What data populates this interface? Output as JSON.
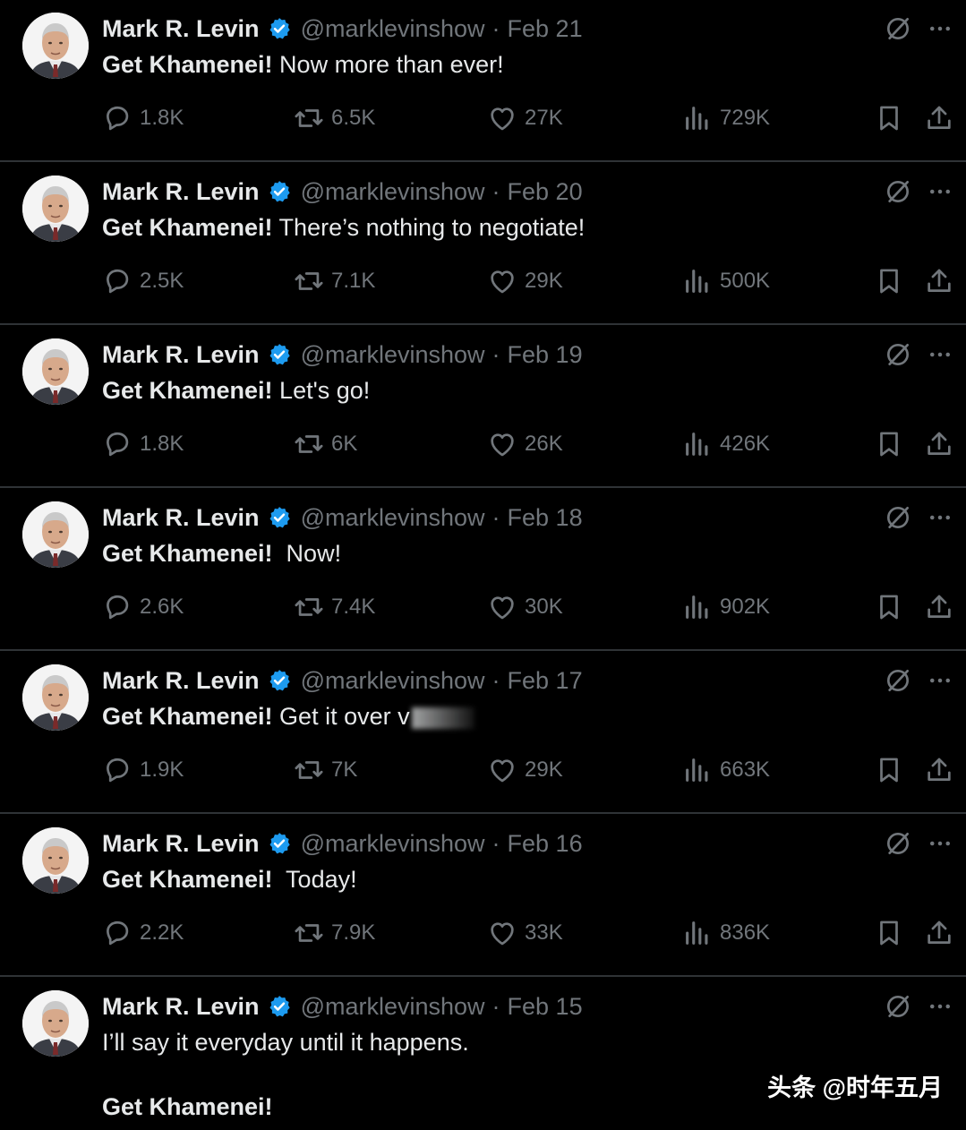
{
  "account": {
    "name": "Mark R. Levin",
    "handle": "@marklevinshow",
    "separator": "·"
  },
  "colors": {
    "background": "#000000",
    "verified": "#1d9bf0",
    "muted": "#71767b",
    "text": "#e7e9ea"
  },
  "icons": {
    "reply": "reply-icon",
    "retweet": "retweet-icon",
    "like": "like-icon",
    "views": "views-icon",
    "bookmark": "bookmark-icon",
    "share": "share-icon",
    "grok": "grok-icon",
    "more": "more-icon",
    "verified": "verified-badge-icon"
  },
  "tweets": [
    {
      "date": "Feb 21",
      "text_bold": "Get Khamenei!",
      "text_rest": " Now more than ever!",
      "replies": "1.8K",
      "retweets": "6.5K",
      "likes": "27K",
      "views": "729K"
    },
    {
      "date": "Feb 20",
      "text_bold": "Get Khamenei!",
      "text_rest": " There’s nothing to negotiate!",
      "replies": "2.5K",
      "retweets": "7.1K",
      "likes": "29K",
      "views": "500K"
    },
    {
      "date": "Feb 19",
      "text_bold": "Get Khamenei!",
      "text_rest": " Let's go!",
      "replies": "1.8K",
      "retweets": "6K",
      "likes": "26K",
      "views": "426K"
    },
    {
      "date": "Feb 18",
      "text_bold": "Get Khamenei!",
      "text_rest": "  Now!",
      "replies": "2.6K",
      "retweets": "7.4K",
      "likes": "30K",
      "views": "902K"
    },
    {
      "date": "Feb 17",
      "text_bold": "Get Khamenei!",
      "text_rest": " Get it over v",
      "replies": "1.9K",
      "retweets": "7K",
      "likes": "29K",
      "views": "663K"
    },
    {
      "date": "Feb 16",
      "text_bold": "Get Khamenei!",
      "text_rest": "  Today!",
      "replies": "2.2K",
      "retweets": "7.9K",
      "likes": "33K",
      "views": "836K"
    },
    {
      "date": "Feb 15",
      "text_line1": "I’ll say it everyday until it happens.",
      "text_bold": "Get Khamenei!"
    }
  ],
  "watermark": "头条 @时年五月"
}
